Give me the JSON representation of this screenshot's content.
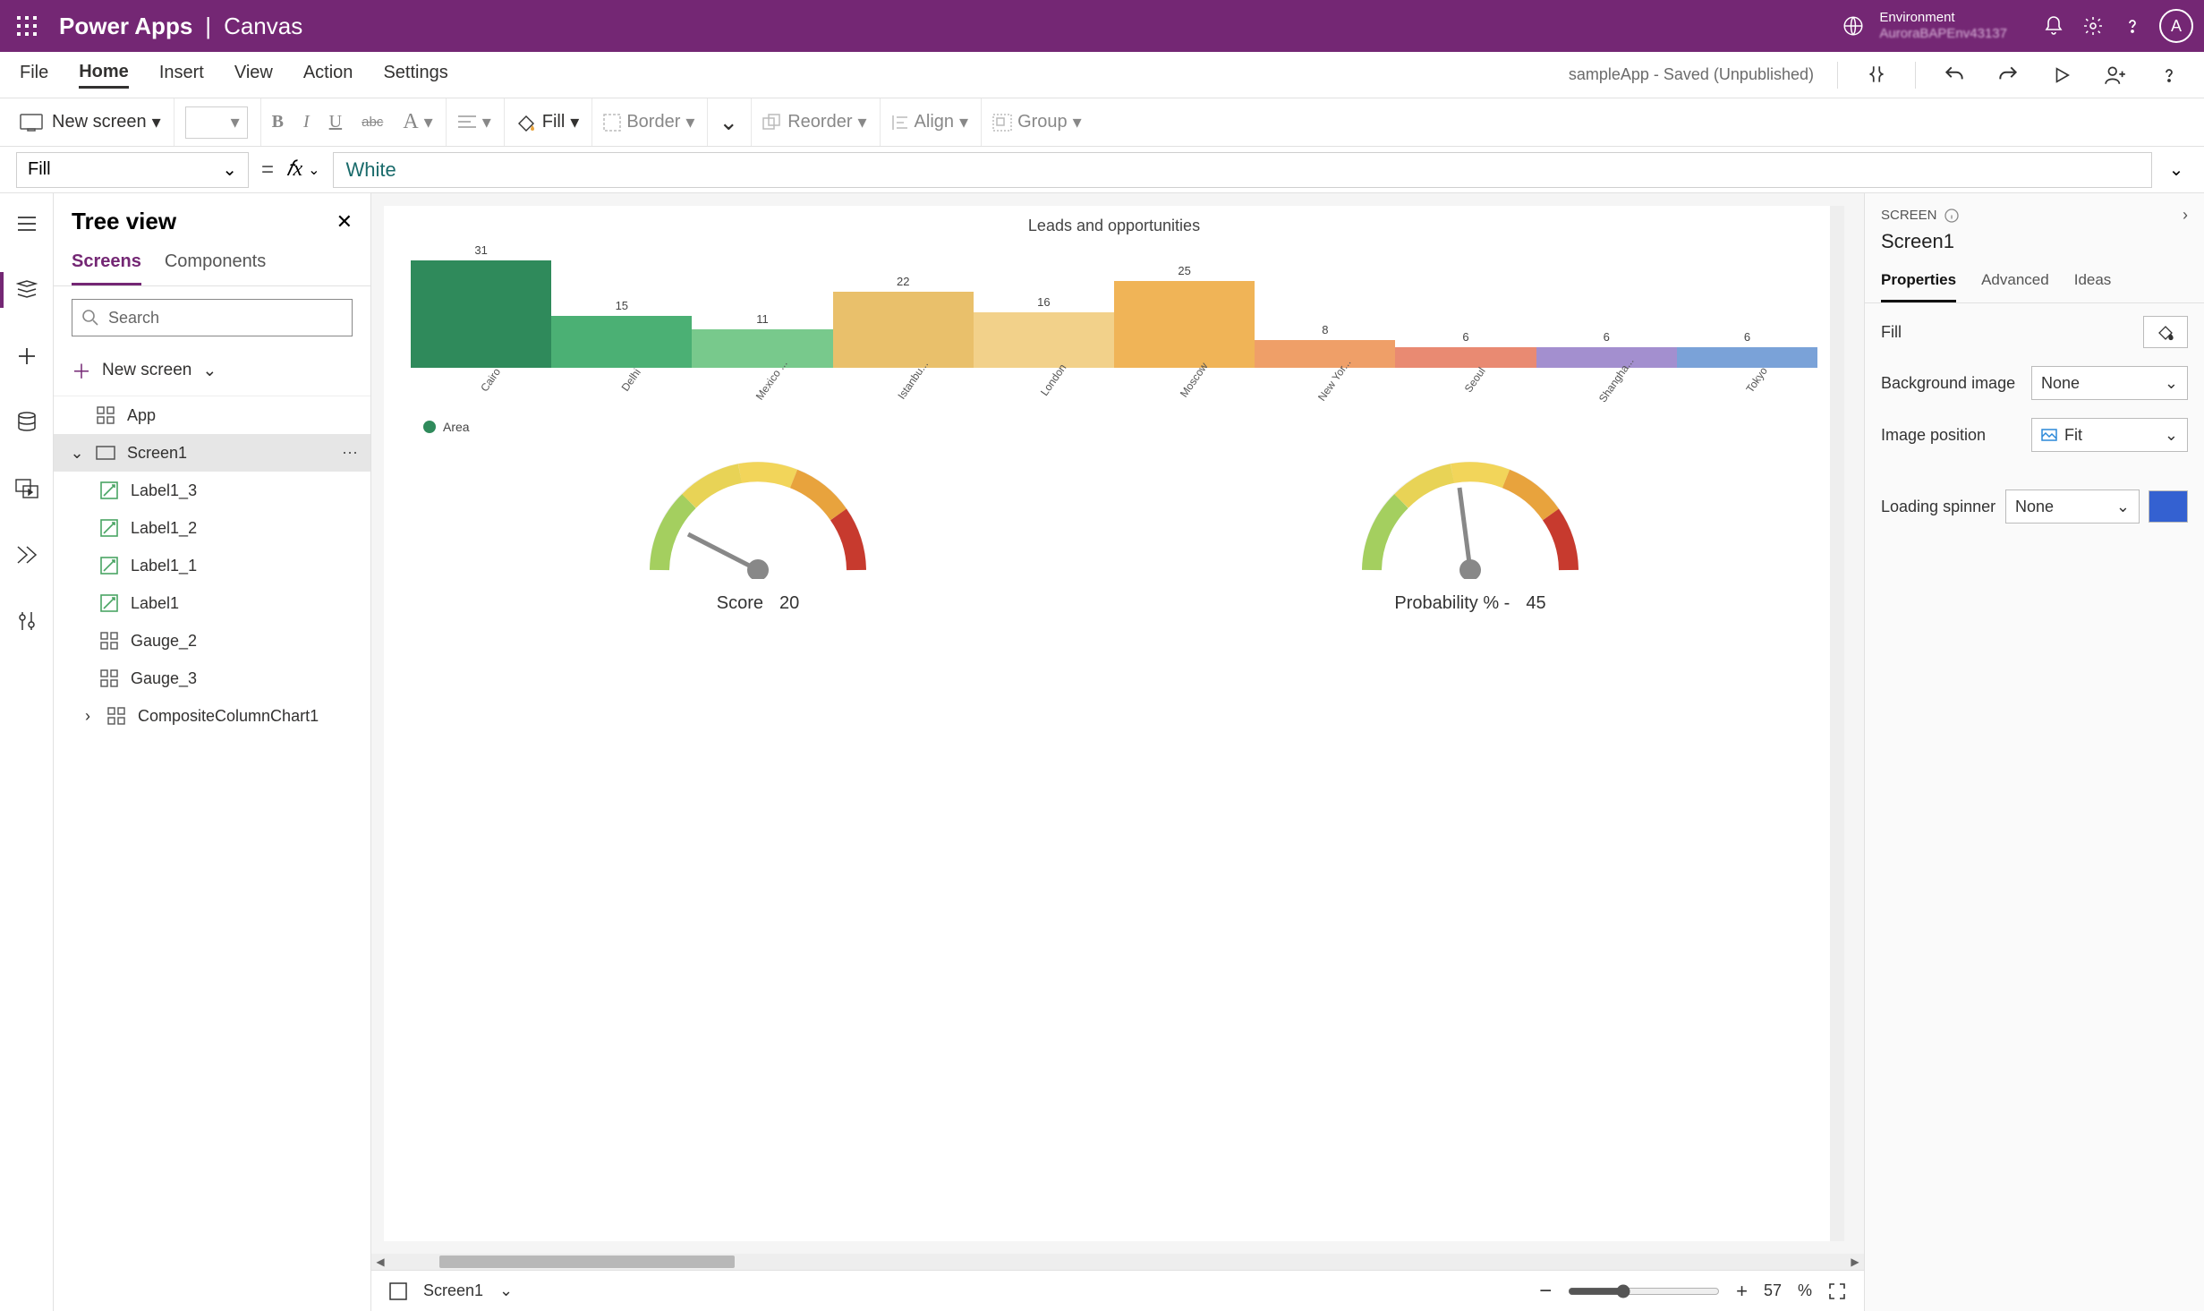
{
  "titlebar": {
    "brand_left": "Power Apps",
    "brand_sep": "|",
    "brand_right": "Canvas",
    "env_label": "Environment",
    "env_value": "AuroraBAPEnv43137",
    "avatar_initial": "A"
  },
  "menubar": {
    "items": [
      "File",
      "Home",
      "Insert",
      "View",
      "Action",
      "Settings"
    ],
    "active": "Home",
    "doc_status": "sampleApp - Saved (Unpublished)"
  },
  "toolbar": {
    "new_screen": "New screen",
    "fill": "Fill",
    "border": "Border",
    "reorder": "Reorder",
    "align": "Align",
    "group": "Group"
  },
  "formulabar": {
    "property": "Fill",
    "value": "White"
  },
  "treeview": {
    "title": "Tree view",
    "tabs": {
      "screens": "Screens",
      "components": "Components"
    },
    "search_placeholder": "Search",
    "new_screen": "New screen",
    "nodes": {
      "app": "App",
      "screen1": "Screen1",
      "children": [
        "Label1_3",
        "Label1_2",
        "Label1_1",
        "Label1",
        "Gauge_2",
        "Gauge_3",
        "CompositeColumnChart1"
      ]
    }
  },
  "canvas": {
    "legend": "Area",
    "gauge1_label": "Score",
    "gauge1_value": "20",
    "gauge2_label": "Probability % -",
    "gauge2_value": "45"
  },
  "chart_data": {
    "type": "bar",
    "title": "Leads and opportunities",
    "series_name": "Area",
    "categories": [
      "Cairo",
      "Delhi",
      "Mexico ...",
      "Istanbu...",
      "London",
      "Moscow",
      "New Yor...",
      "Seoul",
      "Shangha...",
      "Tokyo"
    ],
    "values": [
      31,
      15,
      11,
      22,
      16,
      25,
      8,
      6,
      6,
      6
    ],
    "colors": [
      "#2f8a5b",
      "#4bb074",
      "#78c98c",
      "#e9c06b",
      "#f2d18a",
      "#f0b457",
      "#ef9f68",
      "#e98a72",
      "#a38fcf",
      "#7aa2d8"
    ],
    "ylim": [
      0,
      31
    ]
  },
  "statusbar": {
    "screen_label": "Screen1",
    "zoom_pct": "57",
    "pct_sym": "%"
  },
  "rightpanel": {
    "head": "SCREEN",
    "object": "Screen1",
    "tabs": {
      "properties": "Properties",
      "advanced": "Advanced",
      "ideas": "Ideas"
    },
    "props": {
      "fill": "Fill",
      "bg_image": "Background image",
      "bg_image_v": "None",
      "img_pos": "Image position",
      "img_pos_v": "Fit",
      "spinner": "Loading spinner",
      "spinner_v": "None",
      "spinner_color": "#3461d1"
    }
  }
}
